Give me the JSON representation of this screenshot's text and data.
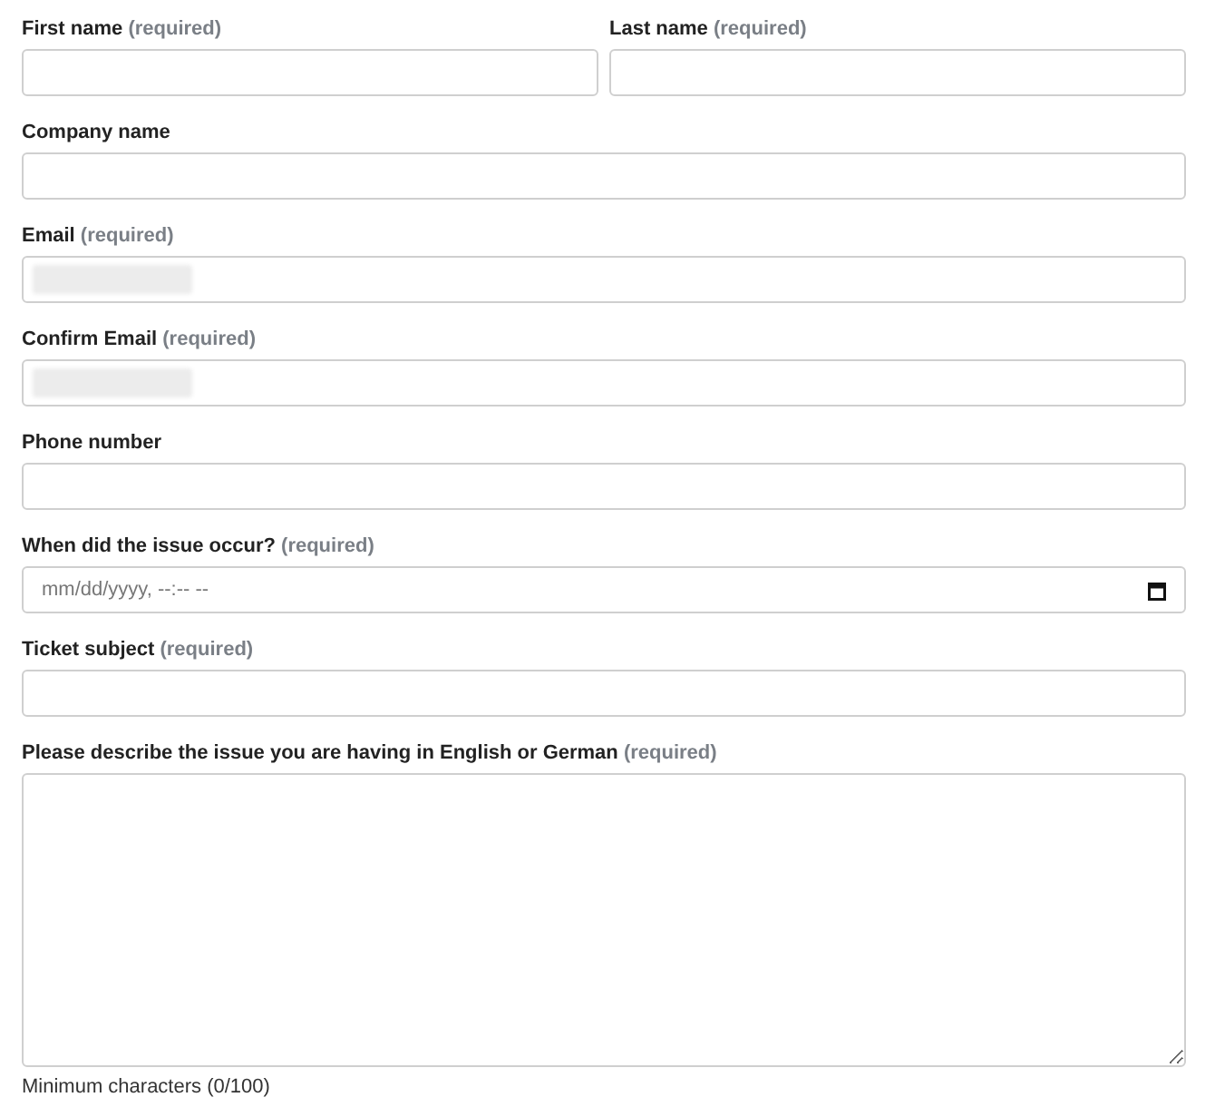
{
  "rows": [
    {
      "fields": [
        {
          "kind": "text",
          "label": "First name",
          "note": "(required)"
        },
        {
          "kind": "text",
          "label": "Last name",
          "note": "(required)"
        }
      ]
    },
    {
      "fields": [
        {
          "kind": "text",
          "label": "Company name"
        }
      ]
    },
    {
      "fields": [
        {
          "kind": "text",
          "label": "Email",
          "note": "(required)",
          "redacted": true
        }
      ]
    },
    {
      "fields": [
        {
          "kind": "text",
          "label": "Confirm Email",
          "note": "(required)",
          "redacted": true
        }
      ]
    },
    {
      "fields": [
        {
          "kind": "text",
          "label": "Phone number"
        }
      ]
    },
    {
      "fields": [
        {
          "kind": "date",
          "label": "When did the issue occur?",
          "note": "(required)",
          "placeholder": "mm/dd/yyyy, --:-- --"
        }
      ]
    },
    {
      "fields": [
        {
          "kind": "text",
          "label": "Ticket subject",
          "note": "(required)"
        }
      ]
    },
    {
      "fields": [
        {
          "kind": "textarea",
          "label": "Please describe the issue you are having in English or German",
          "note": "(required)"
        }
      ]
    }
  ],
  "counter": "Minimum characters (0/100)"
}
